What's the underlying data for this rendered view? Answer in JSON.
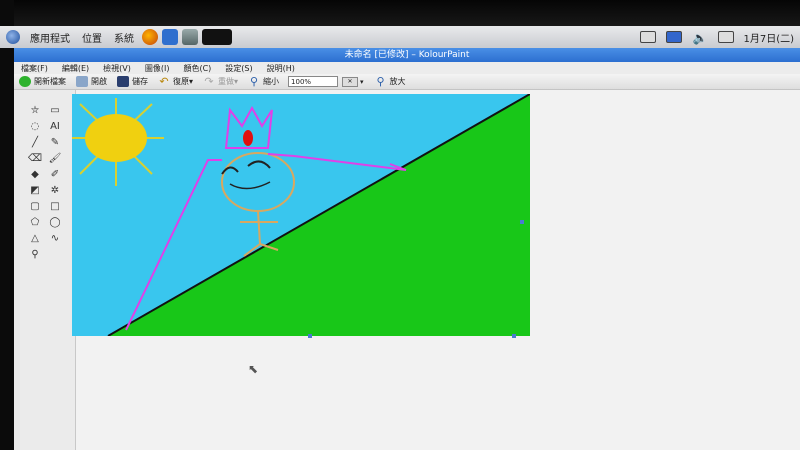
{
  "panel": {
    "menus": [
      "應用程式",
      "位置",
      "系統"
    ],
    "clock": "1月7日(二)"
  },
  "window": {
    "title": "未命名 [已修改] – KolourPaint"
  },
  "menubar": {
    "items": [
      "檔案(F)",
      "編輯(E)",
      "檢視(V)",
      "圖像(I)",
      "顏色(C)",
      "設定(S)",
      "說明(H)"
    ]
  },
  "toolbar": {
    "new_label": "開新檔案",
    "open_label": "開啟",
    "save_label": "儲存",
    "undo_label": "復原",
    "redo_label": "重做",
    "zoom_out_label": "縮小",
    "zoom_value": "100%",
    "zoom_in_label": "放大"
  },
  "tools": [
    {
      "name": "free-form-selection-tool",
      "glyph": "⛦"
    },
    {
      "name": "rectangular-selection-tool",
      "glyph": "▭"
    },
    {
      "name": "elliptical-selection-tool",
      "glyph": "◌"
    },
    {
      "name": "text-tool",
      "glyph": "AI"
    },
    {
      "name": "line-tool",
      "glyph": "╱"
    },
    {
      "name": "pen-tool",
      "glyph": "✎"
    },
    {
      "name": "eraser-tool",
      "glyph": "⌫"
    },
    {
      "name": "brush-tool",
      "glyph": "🖌"
    },
    {
      "name": "flood-fill-tool",
      "glyph": "◆"
    },
    {
      "name": "color-picker-tool",
      "glyph": "✐"
    },
    {
      "name": "color-eraser-tool",
      "glyph": "◩"
    },
    {
      "name": "spraycan-tool",
      "glyph": "✲"
    },
    {
      "name": "rounded-rectangle-tool",
      "glyph": "▢"
    },
    {
      "name": "rectangle-tool",
      "glyph": "□"
    },
    {
      "name": "polygon-tool",
      "glyph": "⬠"
    },
    {
      "name": "ellipse-tool",
      "glyph": "◯"
    },
    {
      "name": "connected-lines-tool",
      "glyph": "△"
    },
    {
      "name": "curve-tool",
      "glyph": "∿"
    },
    {
      "name": "zoom-tool",
      "glyph": "⚲"
    }
  ],
  "colors": {
    "sky": "#39c6ee",
    "grass": "#18c718",
    "sun": "#f0d010",
    "sun_rays": "#d8d030",
    "crown": "#e040e8",
    "stick_figure": "#d8a860",
    "face": "#222222",
    "gem": "#e01010",
    "diagonal": "#111111",
    "workspace": "#f2f2f2"
  }
}
